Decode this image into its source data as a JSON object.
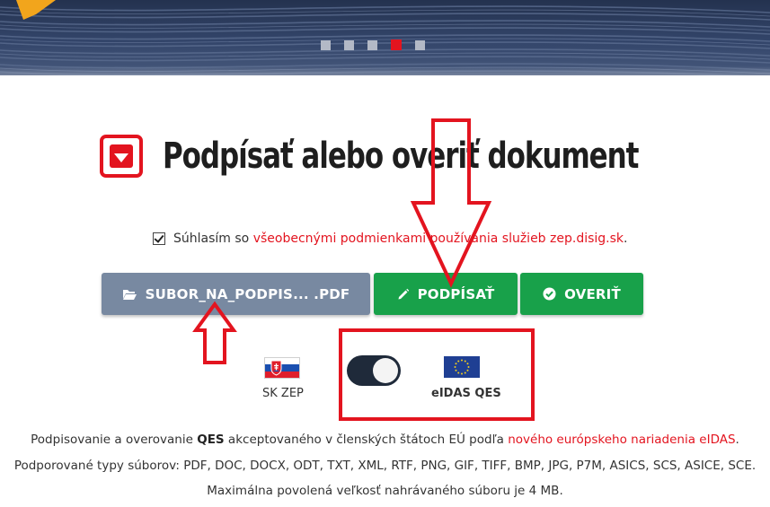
{
  "banner": {
    "slides": [
      {
        "active": false
      },
      {
        "active": false
      },
      {
        "active": false
      },
      {
        "active": true
      },
      {
        "active": false
      }
    ]
  },
  "heading": {
    "title": "Podpísať alebo overiť dokument"
  },
  "consent": {
    "prefix": "Súhlasím so ",
    "link": "všeobecnými podmienkami používania služieb zep.disig.sk",
    "suffix": ".",
    "checked": true
  },
  "buttons": {
    "file_label": "SUBOR_NA_PODPIS... .PDF",
    "file_icon": "folder-open-icon",
    "sign_label": "PODPÍSAŤ",
    "sign_icon": "pencil-icon",
    "verify_label": "OVERIŤ",
    "verify_icon": "check-circle-icon"
  },
  "mode_switch": {
    "left_label": "SK ZEP",
    "left_flag": "slovakia-flag-icon",
    "right_label": "eIDAS QES",
    "right_flag": "eu-flag-icon",
    "selected": "eIDAS QES"
  },
  "info": {
    "line1_a": "Podpisovanie a overovanie ",
    "line1_b": "QES",
    "line1_c": " akceptovaného v členských štátoch EÚ podľa ",
    "line1_link": "nového európskeho nariadenia eIDAS",
    "line1_d": ".",
    "line2": "Podporované typy súborov: PDF, DOC, DOCX, ODT, TXT, XML, RTF, PNG, GIF, TIFF, BMP, JPG, P7M, ASICS, SCS, ASICE, SCE.",
    "line3": "Maximálna povolená veľkosť nahrávaného súboru je 4 MB."
  },
  "colors": {
    "brand_red": "#e3141f",
    "green": "#18a14a",
    "file_button": "#7889a1",
    "toggle_dark": "#1f2a3a"
  }
}
